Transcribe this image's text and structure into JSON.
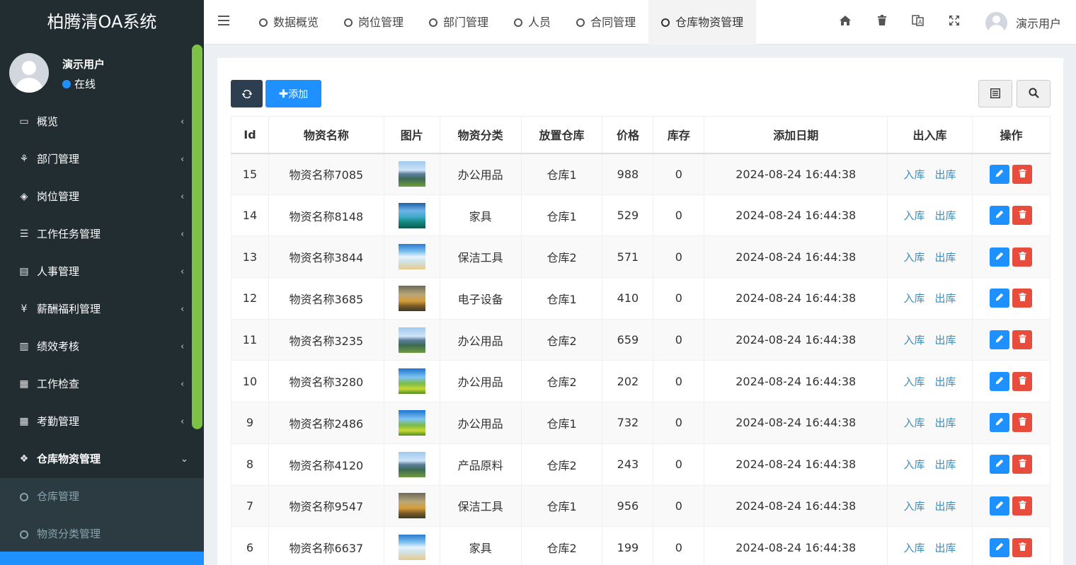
{
  "app": {
    "title": "柏腾清OA系统"
  },
  "user": {
    "name": "演示用户",
    "status": "在线"
  },
  "sidebar": {
    "items": [
      {
        "label": "概览",
        "icon": "desktop-icon"
      },
      {
        "label": "部门管理",
        "icon": "sitemap-icon"
      },
      {
        "label": "岗位管理",
        "icon": "cube-icon"
      },
      {
        "label": "工作任务管理",
        "icon": "list-icon"
      },
      {
        "label": "人事管理",
        "icon": "id-card-icon"
      },
      {
        "label": "薪酬福利管理",
        "icon": "yen-icon"
      },
      {
        "label": "绩效考核",
        "icon": "bar-chart-icon"
      },
      {
        "label": "工作检查",
        "icon": "calculator-icon"
      },
      {
        "label": "考勤管理",
        "icon": "calendar-icon"
      },
      {
        "label": "仓库物资管理",
        "icon": "cubes-icon"
      }
    ],
    "subitems": [
      {
        "label": "仓库管理"
      },
      {
        "label": "物资分类管理"
      }
    ]
  },
  "tabs": [
    {
      "label": "数据概览"
    },
    {
      "label": "岗位管理"
    },
    {
      "label": "部门管理"
    },
    {
      "label": "人员"
    },
    {
      "label": "合同管理"
    },
    {
      "label": "仓库物资管理"
    }
  ],
  "toolbar": {
    "add_label": "添加"
  },
  "table": {
    "headers": [
      "Id",
      "物资名称",
      "图片",
      "物资分类",
      "放置仓库",
      "价格",
      "库存",
      "添加日期",
      "出入库",
      "操作"
    ],
    "in_label": "入库",
    "out_label": "出库",
    "rows": [
      {
        "id": "15",
        "name": "物资名称7085",
        "image": "mountain-lake-thumb",
        "category": "办公用品",
        "warehouse": "仓库1",
        "price": "988",
        "stock": "0",
        "date": "2024-08-24 16:44:38"
      },
      {
        "id": "14",
        "name": "物资名称8148",
        "image": "waterfall-thumb",
        "category": "家具",
        "warehouse": "仓库1",
        "price": "529",
        "stock": "0",
        "date": "2024-08-24 16:44:38"
      },
      {
        "id": "13",
        "name": "物资名称3844",
        "image": "beach-thumb",
        "category": "保洁工具",
        "warehouse": "仓库2",
        "price": "571",
        "stock": "0",
        "date": "2024-08-24 16:44:38"
      },
      {
        "id": "12",
        "name": "物资名称3685",
        "image": "autumn-thumb",
        "category": "电子设备",
        "warehouse": "仓库1",
        "price": "410",
        "stock": "0",
        "date": "2024-08-24 16:44:38"
      },
      {
        "id": "11",
        "name": "物资名称3235",
        "image": "mountain-lake-thumb",
        "category": "办公用品",
        "warehouse": "仓库2",
        "price": "659",
        "stock": "0",
        "date": "2024-08-24 16:44:38"
      },
      {
        "id": "10",
        "name": "物资名称3280",
        "image": "meadow-thumb",
        "category": "办公用品",
        "warehouse": "仓库2",
        "price": "202",
        "stock": "0",
        "date": "2024-08-24 16:44:38"
      },
      {
        "id": "9",
        "name": "物资名称2486",
        "image": "meadow-thumb",
        "category": "办公用品",
        "warehouse": "仓库1",
        "price": "732",
        "stock": "0",
        "date": "2024-08-24 16:44:38"
      },
      {
        "id": "8",
        "name": "物资名称4120",
        "image": "mountain-lake-thumb",
        "category": "产品原料",
        "warehouse": "仓库2",
        "price": "243",
        "stock": "0",
        "date": "2024-08-24 16:44:38"
      },
      {
        "id": "7",
        "name": "物资名称9547",
        "image": "autumn-thumb",
        "category": "保洁工具",
        "warehouse": "仓库1",
        "price": "956",
        "stock": "0",
        "date": "2024-08-24 16:44:38"
      },
      {
        "id": "6",
        "name": "物资名称6637",
        "image": "beach-thumb",
        "category": "家具",
        "warehouse": "仓库2",
        "price": "199",
        "stock": "0",
        "date": "2024-08-24 16:44:38"
      }
    ]
  }
}
